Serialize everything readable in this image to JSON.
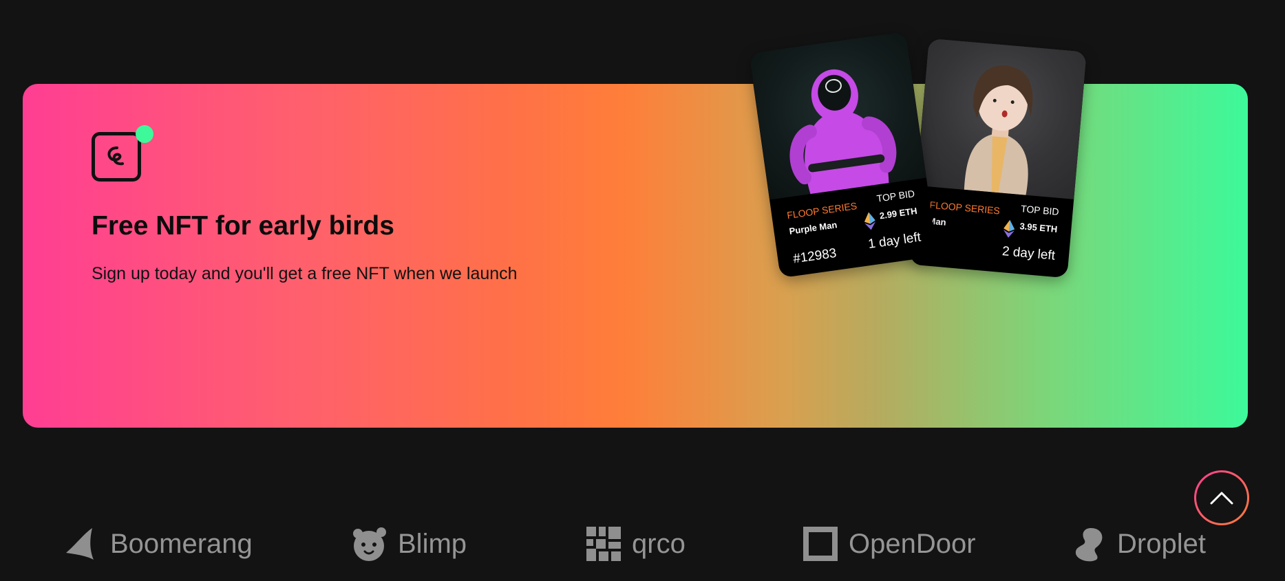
{
  "promo": {
    "title": "Free NFT for early birds",
    "subtitle": "Sign up today and you'll get a free NFT when we launch",
    "accent_color": "#3df99a",
    "gradient_colors": [
      "#ff3e93",
      "#ff7e39",
      "#3df99a"
    ]
  },
  "cards": [
    {
      "series": "FLOOP SERIES",
      "name": "Purple Man",
      "bid_label": "TOP BID",
      "bid_value": "2.99 ETH",
      "token": "#12983",
      "time_left": "1 day left",
      "icon": "ethereum-icon"
    },
    {
      "series": "FLOOP SERIES",
      "name": "Man",
      "bid_label": "TOP BID",
      "bid_value": "3.95 ETH",
      "time_left": "2 day left",
      "icon": "ethereum-icon"
    }
  ],
  "brands": [
    {
      "name": "Boomerang",
      "icon": "boomerang-icon"
    },
    {
      "name": "Blimp",
      "icon": "blimp-icon"
    },
    {
      "name": "qrco",
      "icon": "qrco-icon"
    },
    {
      "name": "OpenDoor",
      "icon": "opendoor-icon"
    },
    {
      "name": "Droplet",
      "icon": "droplet-icon"
    }
  ],
  "scroll_top": {
    "icon": "chevron-up-icon"
  }
}
